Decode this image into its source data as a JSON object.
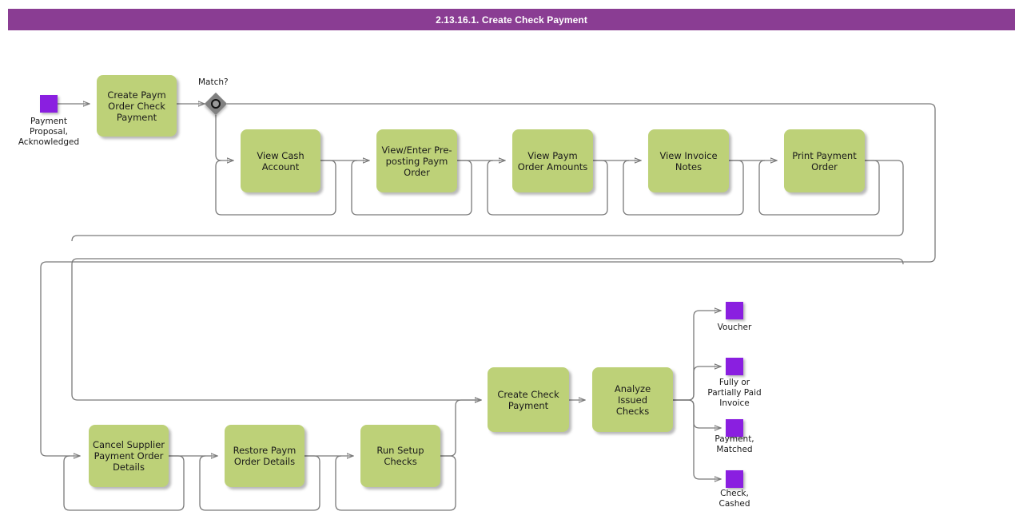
{
  "header": {
    "title": "2.13.16.1. Create Check Payment",
    "bar_color": "#8A3D93",
    "text_color": "#FFFFFF"
  },
  "palette": {
    "task_fill": "#BDD178",
    "event_fill": "#8A1FE0",
    "gateway_fill": "#808080",
    "connector": "#7A7A7A"
  },
  "start_event": {
    "name": "payment-proposal-acknowledged",
    "label": "Payment\nProposal,\nAcknowledged"
  },
  "gateway": {
    "name": "match-gateway",
    "label": "Match?",
    "type": "inclusive"
  },
  "tasks": [
    {
      "id": "create-paym-order-check-payment",
      "label": "Create Paym\nOrder Check\nPayment"
    },
    {
      "id": "view-cash-account",
      "label": "View Cash\nAccount"
    },
    {
      "id": "view-enter-pre-posting-paym-order",
      "label": "View/Enter Pre-\nposting Paym\nOrder"
    },
    {
      "id": "view-paym-order-amounts",
      "label": "View Paym\nOrder Amounts"
    },
    {
      "id": "view-invoice-notes",
      "label": "View Invoice\nNotes"
    },
    {
      "id": "print-payment-order",
      "label": "Print Payment\nOrder"
    },
    {
      "id": "cancel-supplier-payment-order-details",
      "label": "Cancel Supplier\nPayment Order\nDetails"
    },
    {
      "id": "restore-paym-order-details",
      "label": "Restore Paym\nOrder Details"
    },
    {
      "id": "run-setup-checks",
      "label": "Run Setup\nChecks"
    },
    {
      "id": "create-check-payment",
      "label": "Create Check\nPayment"
    },
    {
      "id": "analyze-issued-checks",
      "label": "Analyze\nIssued\nChecks"
    }
  ],
  "end_events": [
    {
      "id": "voucher",
      "label": "Voucher"
    },
    {
      "id": "fully-or-partially-paid-invoice",
      "label": "Fully or\nPartially Paid\nInvoice"
    },
    {
      "id": "payment-matched",
      "label": "Payment,\nMatched"
    },
    {
      "id": "check-cashed",
      "label": "Check,\nCashed"
    }
  ]
}
